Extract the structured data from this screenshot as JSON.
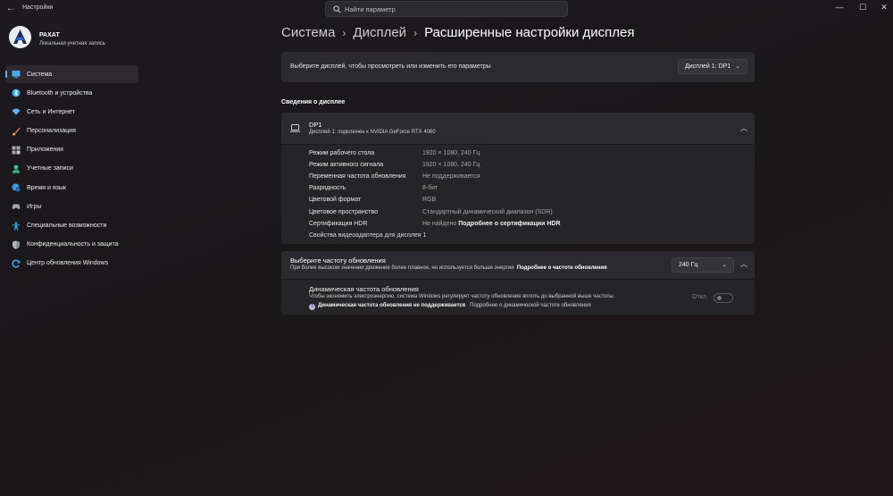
{
  "window": {
    "title": "Настройки",
    "search_placeholder": "Найти параметр",
    "minimize": "—",
    "maximize": "☐",
    "close": "✕"
  },
  "account": {
    "name": "РАХАТ",
    "type": "Локальная учетная запись"
  },
  "sidebar": {
    "items": [
      {
        "label": "Система",
        "icon": "system-icon",
        "color": "#4aa8f0"
      },
      {
        "label": "Bluetooth и устройства",
        "icon": "bluetooth-icon",
        "color": "#3ea7ef"
      },
      {
        "label": "Сеть и Интернет",
        "icon": "wifi-icon",
        "color": "#5ab4f4"
      },
      {
        "label": "Персонализация",
        "icon": "brush-icon",
        "color": "#e98a5c"
      },
      {
        "label": "Приложения",
        "icon": "apps-icon",
        "color": "#a7a7ad"
      },
      {
        "label": "Учетные записи",
        "icon": "person-icon",
        "color": "#39c78b"
      },
      {
        "label": "Время и язык",
        "icon": "globe-clock-icon",
        "color": "#3e9fe8"
      },
      {
        "label": "Игры",
        "icon": "gamepad-icon",
        "color": "#9fa4ad"
      },
      {
        "label": "Специальные возможности",
        "icon": "accessibility-icon",
        "color": "#3e9fe8"
      },
      {
        "label": "Конфиденциальность и защита",
        "icon": "shield-icon",
        "color": "#8e939a"
      },
      {
        "label": "Центр обновления Windows",
        "icon": "update-icon",
        "color": "#3e9fe8"
      }
    ]
  },
  "breadcrumb": {
    "level1": "Система",
    "level2": "Дисплей",
    "current": "Расширенные настройки дисплея",
    "separator": "›"
  },
  "display_select": {
    "label": "Выберите дисплей, чтобы просмотреть или изменить его параметры",
    "value": "Дисплей 1: DP1"
  },
  "display_info": {
    "section_title": "Сведения о дисплее",
    "name": "DP1",
    "subtitle": "Дисплей 1: подключен к NVIDIA GeForce RTX 4060",
    "rows": [
      {
        "label": "Режим рабочего стола",
        "value": "1920 × 1080, 240 Гц"
      },
      {
        "label": "Режим активного сигнала",
        "value": "1920 × 1080, 240 Гц"
      },
      {
        "label": "Переменная частота обновления",
        "value": "Не поддерживается"
      },
      {
        "label": "Разрядность",
        "value": "8-бит"
      },
      {
        "label": "Цветовой формат",
        "value": "RGB"
      },
      {
        "label": "Цветовое пространство",
        "value": "Стандартный динамический диапазон (SDR)"
      },
      {
        "label": "Сертификация HDR",
        "value": "Не найдено",
        "link": "Подробнее о сертификации HDR"
      }
    ],
    "adapter_link": "Свойства видеоадаптера для дисплея 1"
  },
  "refresh": {
    "title": "Выберите частоту обновления",
    "subtitle": "При более высоком значении движение более плавное, но используется больше энергии",
    "link": "Подробнее о частоте обновления",
    "value": "240 Гц"
  },
  "dynamic_refresh": {
    "title": "Динамическая частота обновления",
    "subtitle": "Чтобы экономить электроэнергию, система Windows регулирует частоту обновления вплоть до выбранной выше частоты.",
    "note": "Динамическая частота обновления не поддерживается",
    "note_link": "Подробнее о динамической частоте обновления",
    "toggle_label": "Откл."
  }
}
